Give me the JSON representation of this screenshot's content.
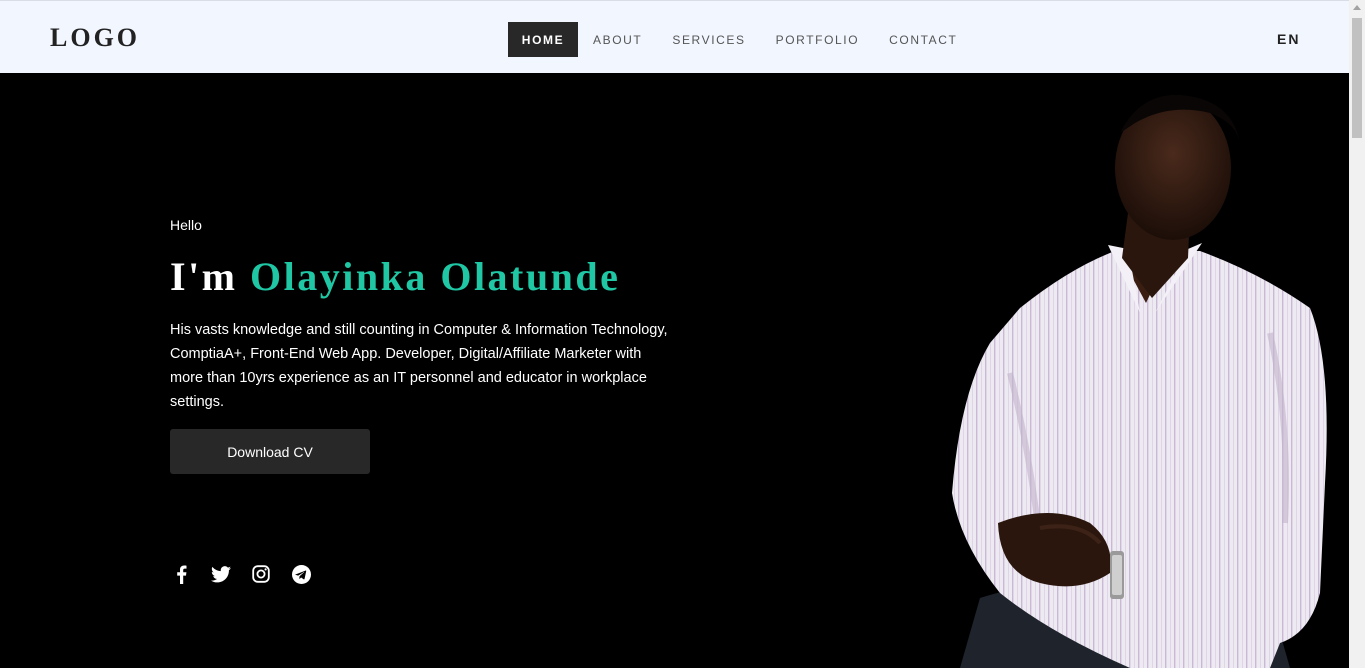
{
  "header": {
    "logo": "LOGO",
    "nav": [
      {
        "label": "HOME",
        "active": true
      },
      {
        "label": "ABOUT",
        "active": false
      },
      {
        "label": "SERVICES",
        "active": false
      },
      {
        "label": "PORTFOLIO",
        "active": false
      },
      {
        "label": "CONTACT",
        "active": false
      }
    ],
    "language": "EN"
  },
  "hero": {
    "greeting": "Hello",
    "intro": "I'm",
    "name": "Olayinka Olatunde",
    "bio": "His vasts knowledge and still counting in Computer & Information Technology, ComptiaA+, Front-End Web App. Developer, Digital/Affiliate Marketer with more than 10yrs experience as an IT personnel and educator in workplace settings.",
    "cv_button": "Download CV",
    "socials": [
      "facebook-icon",
      "twitter-icon",
      "instagram-icon",
      "telegram-icon"
    ]
  },
  "colors": {
    "accent": "#1fc7a4",
    "nav_bg": "#f2f6ff",
    "hero_bg": "#000000",
    "button_bg": "#282828"
  }
}
